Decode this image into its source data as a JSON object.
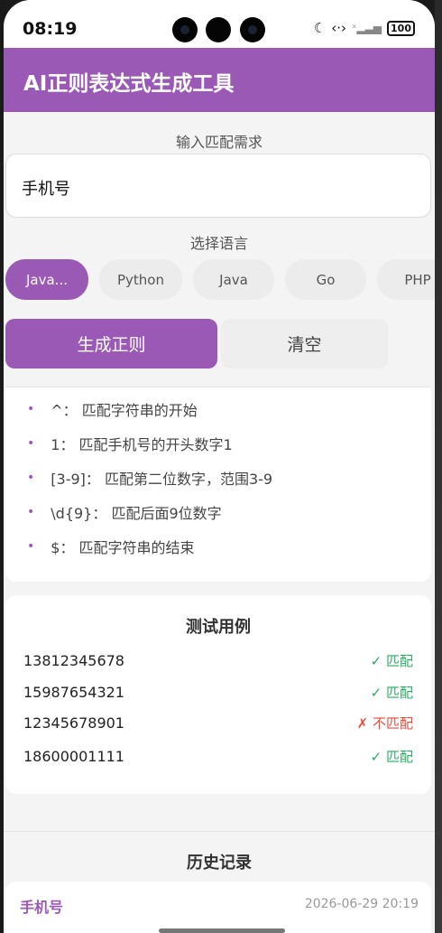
{
  "status_bar": {
    "time": "08:19",
    "battery": "100"
  },
  "app_bar": {
    "title": "AI正则表达式生成工具"
  },
  "input_section": {
    "label": "输入匹配需求",
    "value": "手机号"
  },
  "language_section": {
    "label": "选择语言",
    "chips": [
      "Java...",
      "Python",
      "Java",
      "Go",
      "PHP"
    ],
    "selected_index": 0
  },
  "buttons": {
    "generate": "生成正则",
    "clear": "清空"
  },
  "explanation": [
    "^： 匹配字符串的开始",
    "1： 匹配手机号的开头数字1",
    "[3-9]： 匹配第二位数字，范围3-9",
    "\\d{9}： 匹配后面9位数字",
    "$： 匹配字符串的结束"
  ],
  "tests": {
    "title": "测试用例",
    "rows": [
      {
        "number": "13812345678",
        "result": "✓ 匹配",
        "match": true
      },
      {
        "number": "15987654321",
        "result": "✓ 匹配",
        "match": true
      },
      {
        "number": "12345678901",
        "result": "✗ 不匹配",
        "match": false
      },
      {
        "number": "18600001111",
        "result": "✓ 匹配",
        "match": true
      }
    ]
  },
  "history": {
    "title": "历史记录",
    "items": [
      {
        "name": "手机号",
        "time": "2026-06-29 20:19"
      }
    ]
  },
  "colors": {
    "accent": "#9b59b6",
    "success": "#27ae60",
    "error": "#e74c3c"
  }
}
